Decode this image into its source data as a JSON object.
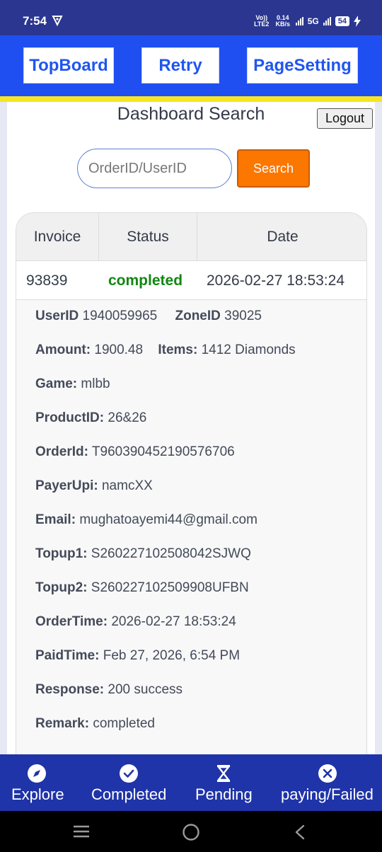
{
  "status_bar": {
    "time": "7:54",
    "volte": "Vo)) LTE2",
    "speed": "0.14 KB/s",
    "network": "5G",
    "battery": "54"
  },
  "topnav": {
    "topboard": "TopBoard",
    "retry": "Retry",
    "pagesetting": "PageSetting"
  },
  "page": {
    "title": "Dashboard Search",
    "logout": "Logout",
    "search_placeholder": "OrderID/UserID",
    "search_button": "Search"
  },
  "table": {
    "headers": [
      "Invoice",
      "Status",
      "Date"
    ],
    "row": {
      "invoice": "93839",
      "status": "completed",
      "date": "2026-02-27 18:53:24"
    }
  },
  "details": {
    "userid_label": "UserID",
    "userid": "1940059965",
    "zoneid_label": "ZoneID",
    "zoneid": "39025",
    "amount_label": "Amount:",
    "amount": "1900.48",
    "items_label": "Items:",
    "items": "1412 Diamonds",
    "game_label": "Game:",
    "game": "mlbb",
    "productid_label": "ProductID:",
    "productid": "26&26",
    "orderid_label": "OrderId:",
    "orderid": "T960390452190576706",
    "payerupi_label": "PayerUpi:",
    "payerupi": "namcXX",
    "email_label": "Email:",
    "email": "mughatoayemi44@gmail.com",
    "topup1_label": "Topup1:",
    "topup1": "S260227102508042SJWQ",
    "topup2_label": "Topup2:",
    "topup2": "S260227102509908UFBN",
    "ordertime_label": "OrderTime:",
    "ordertime": "2026-02-27 18:53:24",
    "paidtime_label": "PaidTime:",
    "paidtime": "Feb 27, 2026, 6:54 PM",
    "response_label": "Response:",
    "response": "200 success",
    "remark_label": "Remark:",
    "remark": "completed"
  },
  "bottomnav": {
    "explore": "Explore",
    "completed": "Completed",
    "pending": "Pending",
    "failed": "paying/Failed"
  },
  "colors": {
    "primary_blue": "#1f4ff0",
    "accent_yellow": "#f7e524",
    "search_orange": "#fc7700",
    "status_green": "#138613",
    "bottom_nav": "#1f34a8"
  }
}
